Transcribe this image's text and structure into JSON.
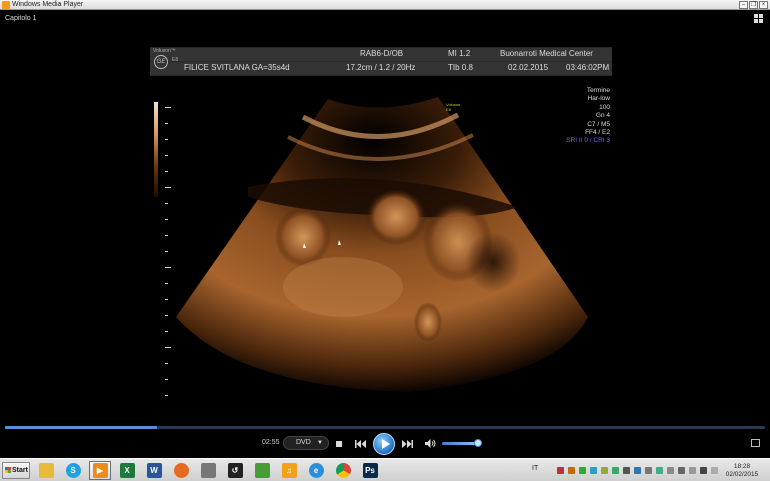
{
  "window": {
    "title": "Windows Media Player"
  },
  "player": {
    "chapter": "Capitolo 1",
    "current_time": "02:55",
    "source": "DVD",
    "seek_progress": 0.2,
    "volume": 0.85
  },
  "ultrasound": {
    "brand": "Voluson™",
    "model": "E8",
    "logo_text": "GE",
    "header": {
      "probe": "RAB6-D/OB",
      "mi": "MI  1.2",
      "center": "Buonarroti Medical Center",
      "patient": "FILICE SVITLANA  GA=35s4d",
      "depth": "17.2cm / 1.2 / 20Hz",
      "tib": "TIb  0.8",
      "date": "02.02.2015",
      "time": "03:46:02PM"
    },
    "params": [
      "Termine",
      "Har-low",
      "100",
      "Gn   4",
      "C7 / M5",
      "FF4 / E2"
    ],
    "sri": "SRI II 0 / CRI 3",
    "small_logo": [
      "Voluson",
      "E8"
    ]
  },
  "taskbar": {
    "start_label": "Start",
    "language": "IT",
    "clock_time": "18:28",
    "clock_date": "02/02/2015",
    "apps": [
      {
        "name": "explorer",
        "icon": "folder-icon",
        "glyph": "",
        "color": "#e7b93c"
      },
      {
        "name": "skype",
        "icon": "skype-icon",
        "glyph": "S",
        "color": "#1fa2e2"
      },
      {
        "name": "media-player",
        "icon": "media-player-icon",
        "glyph": "▶",
        "color": "#f08a1d"
      },
      {
        "name": "excel",
        "icon": "excel-icon",
        "glyph": "X",
        "color": "#1e7a3c"
      },
      {
        "name": "word",
        "icon": "word-icon",
        "glyph": "W",
        "color": "#2a5699"
      },
      {
        "name": "firefox",
        "icon": "firefox-icon",
        "glyph": "",
        "color": "#e66b1f"
      },
      {
        "name": "printer",
        "icon": "printer-icon",
        "glyph": "",
        "color": "#777777"
      },
      {
        "name": "backup",
        "icon": "backup-icon",
        "glyph": "↺",
        "color": "#222222"
      },
      {
        "name": "notepad",
        "icon": "notepad-icon",
        "glyph": "",
        "color": "#4a9a3a"
      },
      {
        "name": "music",
        "icon": "headphones-icon",
        "glyph": "♫",
        "color": "#f2a11a"
      },
      {
        "name": "internet-explorer",
        "icon": "ie-icon",
        "glyph": "e",
        "color": "#2b8fd8"
      },
      {
        "name": "chrome",
        "icon": "chrome-icon",
        "glyph": "",
        "color": "#db4437"
      },
      {
        "name": "photoshop",
        "icon": "photoshop-icon",
        "glyph": "Ps",
        "color": "#0b2a4a"
      }
    ]
  }
}
